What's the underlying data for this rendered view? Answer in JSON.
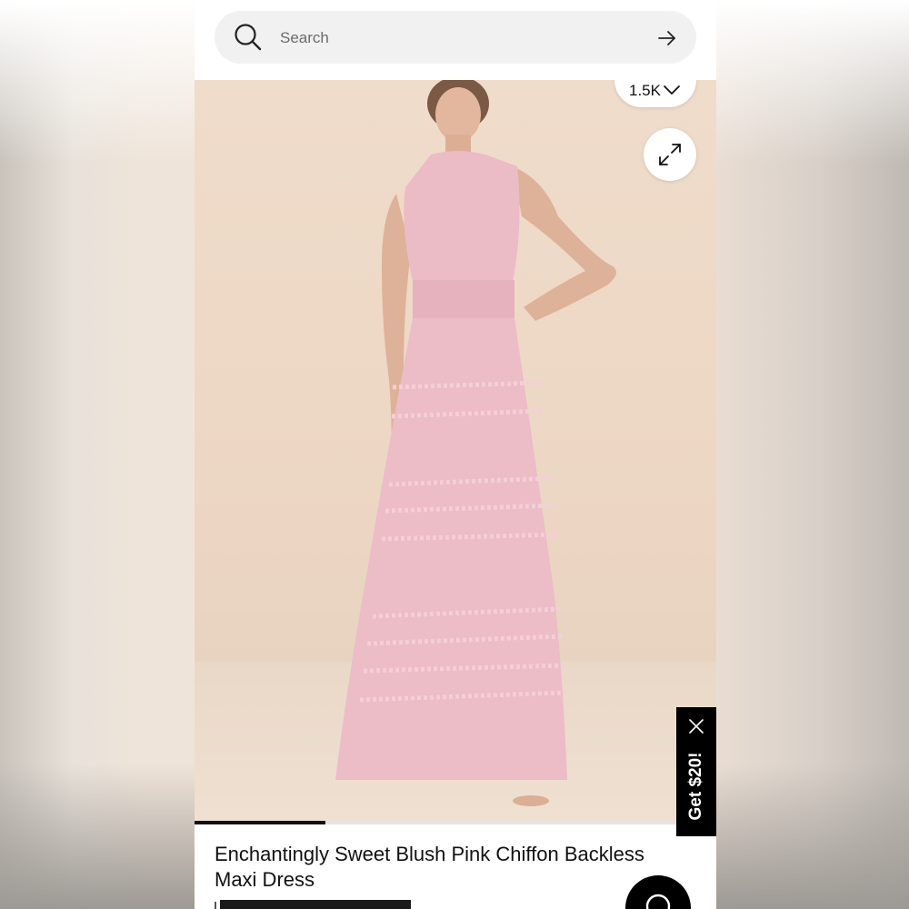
{
  "search": {
    "placeholder": "Search",
    "icon": "search-icon",
    "submit_icon": "arrow-right-icon"
  },
  "gallery": {
    "likes_count": "1.5K",
    "likes_icon": "chevron-down-icon",
    "expand_icon": "expand-icon",
    "progress_fraction": 0.25,
    "colors": {
      "background": "#ecd6c3",
      "dress": "#e9b9c4"
    }
  },
  "promo": {
    "label": "Get $20!",
    "close_icon": "close-icon"
  },
  "product": {
    "title": "Enchantingly Sweet Blush Pink Chiffon Backless Maxi Dress"
  },
  "chat": {
    "icon": "chat-icon"
  }
}
